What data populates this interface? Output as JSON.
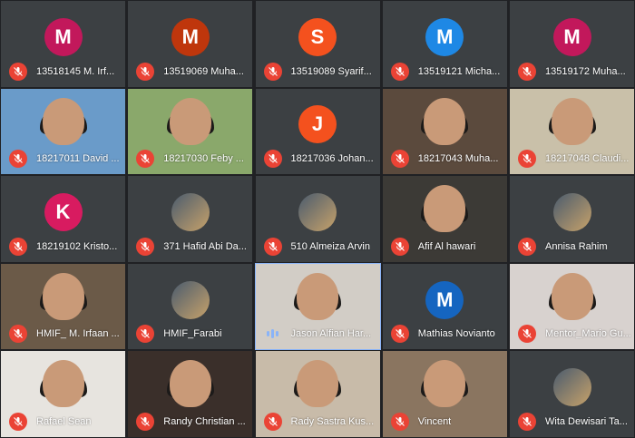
{
  "participants": [
    {
      "name": "13518145 M. Irf...",
      "type": "avatar",
      "initial": "M",
      "color": "#c2185b",
      "muted": true
    },
    {
      "name": "13519069 Muha...",
      "type": "avatar",
      "initial": "M",
      "color": "#bf360c",
      "muted": true
    },
    {
      "name": "13519089 Syarif...",
      "type": "avatar",
      "initial": "S",
      "color": "#f4511e",
      "muted": true
    },
    {
      "name": "13519121 Micha...",
      "type": "avatar",
      "initial": "M",
      "color": "#1e88e5",
      "muted": true
    },
    {
      "name": "13519172 Muha...",
      "type": "avatar",
      "initial": "M",
      "color": "#c2185b",
      "muted": true
    },
    {
      "name": "18217011 David ...",
      "type": "video",
      "bg": "#6a9bc9",
      "muted": true
    },
    {
      "name": "18217030 Feby ...",
      "type": "video",
      "bg": "#8aa86b",
      "muted": true
    },
    {
      "name": "18217036 Johan...",
      "type": "avatar",
      "initial": "J",
      "color": "#f4511e",
      "muted": true
    },
    {
      "name": "18217043 Muha...",
      "type": "video",
      "bg": "#5b4a3d",
      "muted": true
    },
    {
      "name": "18217048 Claudi...",
      "type": "video",
      "bg": "#c9c0a9",
      "muted": true
    },
    {
      "name": "18219102 Kristo...",
      "type": "avatar",
      "initial": "K",
      "color": "#d81b60",
      "muted": true
    },
    {
      "name": "371 Hafid Abi Da...",
      "type": "photo",
      "muted": true
    },
    {
      "name": "510 Almeiza Arvin",
      "type": "photo",
      "muted": true
    },
    {
      "name": "Afif Al hawari",
      "type": "video",
      "bg": "#3c3a36",
      "muted": true
    },
    {
      "name": "Annisa Rahim",
      "type": "photo",
      "muted": true
    },
    {
      "name": "HMIF_ M. Irfaan ...",
      "type": "video",
      "bg": "#6b5a48",
      "muted": true
    },
    {
      "name": "HMIF_Farabi",
      "type": "photo",
      "muted": true
    },
    {
      "name": "Jason Alfian Har...",
      "type": "video",
      "bg": "#d2cdc6",
      "muted": false,
      "speaking": true
    },
    {
      "name": "Mathias Novianto",
      "type": "avatar",
      "initial": "M",
      "color": "#1565c0",
      "muted": true
    },
    {
      "name": "Mentor_Mario Gu...",
      "type": "video",
      "bg": "#d8d2cf",
      "muted": true
    },
    {
      "name": "Rafael Sean",
      "type": "video",
      "bg": "#e7e4df",
      "muted": true
    },
    {
      "name": "Randy Christian ...",
      "type": "video",
      "bg": "#3a2f2a",
      "muted": true
    },
    {
      "name": "Rady Sastra Kus...",
      "type": "video",
      "bg": "#c8bba9",
      "muted": true
    },
    {
      "name": "Vincent",
      "type": "video",
      "bg": "#8a7560",
      "muted": true
    },
    {
      "name": "Wita Dewisari Ta...",
      "type": "photo",
      "muted": true
    }
  ]
}
